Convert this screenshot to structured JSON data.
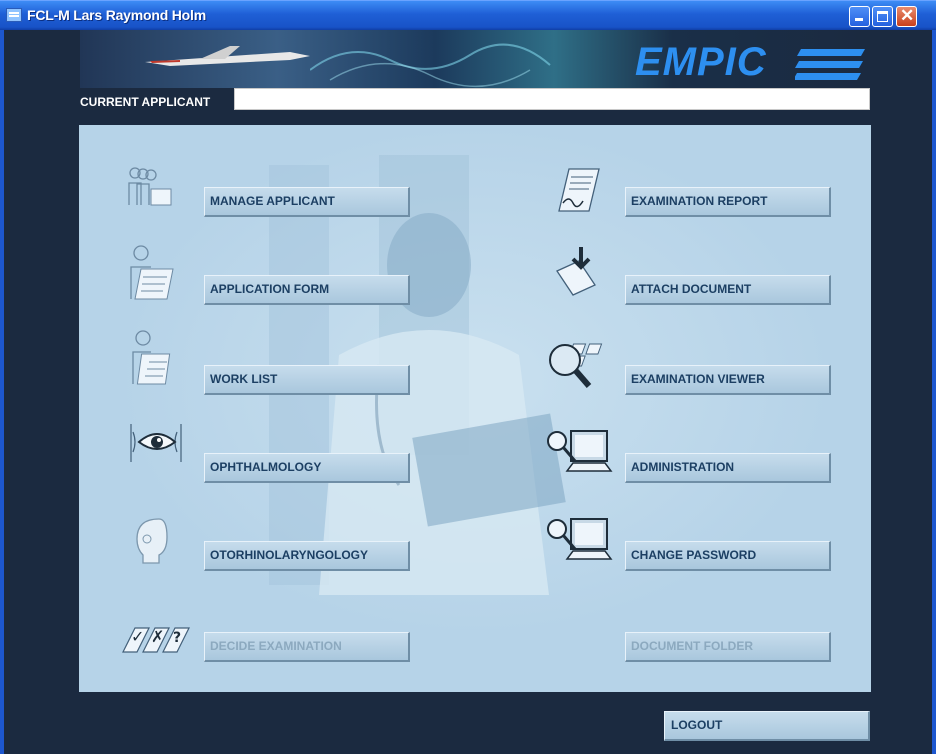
{
  "window": {
    "title": "FCL-M Lars Raymond Holm"
  },
  "banner": {
    "logo_text": "EMPIC"
  },
  "applicant": {
    "label": "CURRENT APPLICANT",
    "value": ""
  },
  "menu_left": [
    {
      "label": "MANAGE APPLICANT",
      "enabled": true,
      "icon": "people-form-icon"
    },
    {
      "label": "APPLICATION FORM",
      "enabled": true,
      "icon": "person-document-icon"
    },
    {
      "label": "WORK LIST",
      "enabled": true,
      "icon": "person-checklist-icon"
    },
    {
      "label": "OPHTHALMOLOGY",
      "enabled": true,
      "icon": "eye-icon"
    },
    {
      "label": "OTORHINOLARYNGOLOGY",
      "enabled": true,
      "icon": "head-profile-icon"
    },
    {
      "label": "DECIDE EXAMINATION",
      "enabled": false,
      "icon": "check-cross-question-icon"
    }
  ],
  "menu_right": [
    {
      "label": "EXAMINATION REPORT",
      "enabled": true,
      "icon": "report-signature-icon"
    },
    {
      "label": "ATTACH DOCUMENT",
      "enabled": true,
      "icon": "attach-folder-icon"
    },
    {
      "label": "EXAMINATION VIEWER",
      "enabled": true,
      "icon": "magnifier-icon"
    },
    {
      "label": "ADMINISTRATION",
      "enabled": true,
      "icon": "key-computer-icon"
    },
    {
      "label": "CHANGE PASSWORD",
      "enabled": true,
      "icon": "key-computer-icon"
    },
    {
      "label": "DOCUMENT FOLDER",
      "enabled": false,
      "icon": "folder-icon"
    }
  ],
  "footer": {
    "logout_label": "LOGOUT"
  },
  "colors": {
    "panel": "#b6d3e8",
    "background": "#1b2a40",
    "button_text": "#1c3f63",
    "logo": "#2d8ff0"
  }
}
